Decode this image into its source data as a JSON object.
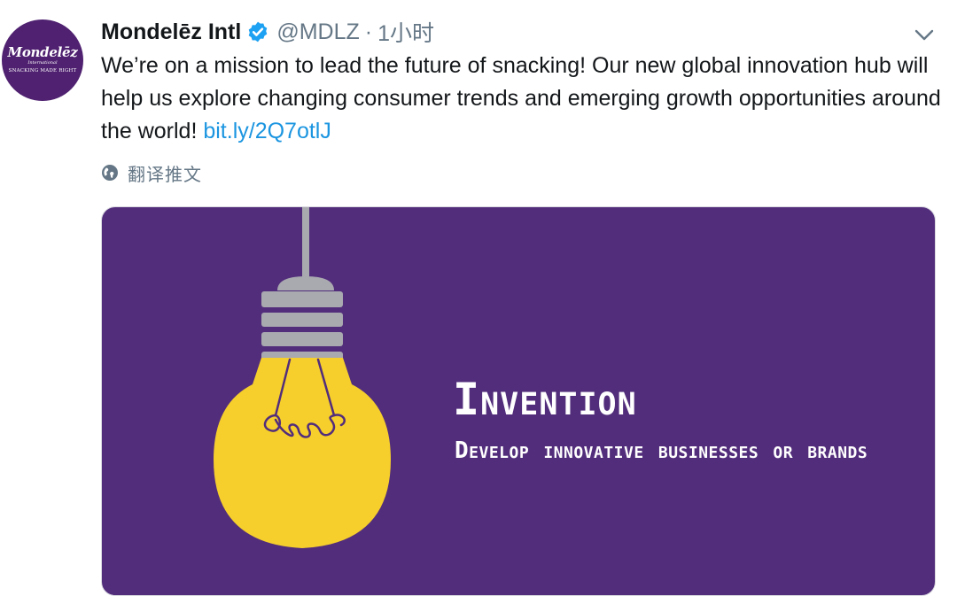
{
  "account": {
    "avatar_brand": "Mondelēz",
    "avatar_sub": "International",
    "avatar_tagline": "SNACKING MADE RIGHT",
    "name": "Mondelēz Intl",
    "handle": "@MDLZ",
    "separator": "·",
    "time": "1小时"
  },
  "tweet": {
    "text": "We’re on a mission to lead the future of snacking! Our new global innovation hub will help us explore changing consumer trends and emerging growth opportunities around the world! ",
    "link": "bit.ly/2Q7otlJ",
    "translate_label": "翻译推文"
  },
  "card": {
    "title": "Invention",
    "description": "Develop innovative businesses or brands"
  },
  "colors": {
    "brand_purple": "#4f2170",
    "card_purple": "#522d7b",
    "bulb_yellow": "#f6cf2c",
    "link_blue": "#1b95e0",
    "verified_blue": "#1da1f2",
    "muted_gray": "#657786"
  },
  "icons": [
    "verified-badge-icon",
    "chevron-down-icon",
    "globe-icon",
    "lightbulb-illustration"
  ]
}
